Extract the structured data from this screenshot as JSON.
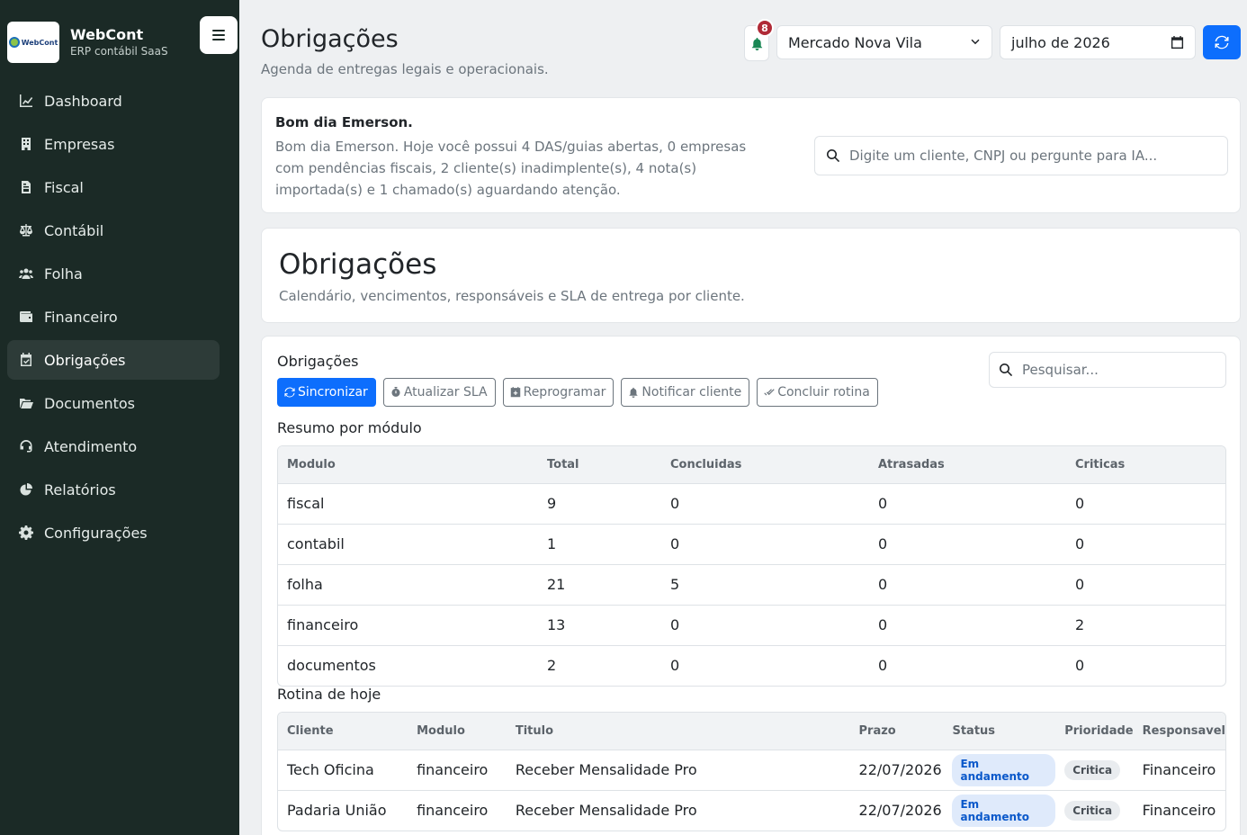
{
  "app": {
    "name": "WebCont",
    "tagline": "ERP contábil SaaS",
    "logo_text": "WebCont"
  },
  "sidebar": {
    "items": [
      {
        "label": "Dashboard",
        "icon": "chart-line-icon"
      },
      {
        "label": "Empresas",
        "icon": "building-icon"
      },
      {
        "label": "Fiscal",
        "icon": "file-invoice-icon"
      },
      {
        "label": "Contábil",
        "icon": "scale-icon"
      },
      {
        "label": "Folha",
        "icon": "users-icon"
      },
      {
        "label": "Financeiro",
        "icon": "wallet-icon"
      },
      {
        "label": "Obrigações",
        "icon": "calendar-check-icon",
        "active": true
      },
      {
        "label": "Documentos",
        "icon": "folder-open-icon"
      },
      {
        "label": "Atendimento",
        "icon": "headset-icon"
      },
      {
        "label": "Relatórios",
        "icon": "chart-pie-icon"
      },
      {
        "label": "Configurações",
        "icon": "gear-icon"
      }
    ]
  },
  "header": {
    "title": "Obrigações",
    "subtitle": "Agenda de entregas legais e operacionais.",
    "notification_count": "8",
    "company": "Mercado Nova Vila",
    "period": "julho de 2026"
  },
  "greeting": {
    "title": "Bom dia Emerson.",
    "text": "Bom dia Emerson. Hoje você possui 4 DAS/guias abertas, 0 empresas com pendências fiscais, 2 cliente(s) inadimplente(s), 4 nota(s) importada(s) e 1 chamado(s) aguardando atenção.",
    "search_placeholder": "Digite um cliente, CNPJ ou pergunte para IA..."
  },
  "hero": {
    "title": "Obrigações",
    "subtitle": "Calendário, vencimentos, responsáveis e SLA de entrega por cliente."
  },
  "panel": {
    "title": "Obrigações",
    "search_placeholder": "Pesquisar...",
    "buttons": {
      "sync": "Sincronizar",
      "sla": "Atualizar SLA",
      "reschedule": "Reprogramar",
      "notify": "Notificar cliente",
      "finish": "Concluir rotina"
    },
    "summary_title": "Resumo por módulo",
    "summary_headers": [
      "Modulo",
      "Total",
      "Concluidas",
      "Atrasadas",
      "Criticas"
    ],
    "summary_rows": [
      [
        "fiscal",
        "9",
        "0",
        "0",
        "0"
      ],
      [
        "contabil",
        "1",
        "0",
        "0",
        "0"
      ],
      [
        "folha",
        "21",
        "5",
        "0",
        "0"
      ],
      [
        "financeiro",
        "13",
        "0",
        "0",
        "2"
      ],
      [
        "documentos",
        "2",
        "0",
        "0",
        "0"
      ]
    ],
    "routine_title": "Rotina de hoje",
    "routine_headers": [
      "Cliente",
      "Modulo",
      "Titulo",
      "Prazo",
      "Status",
      "Prioridade",
      "Responsavel"
    ],
    "routine_rows": [
      [
        "Tech Oficina",
        "financeiro",
        "Receber Mensalidade Pro",
        "22/07/2026",
        "Em andamento",
        "Critica",
        "Financeiro"
      ],
      [
        "Padaria União",
        "financeiro",
        "Receber Mensalidade Pro",
        "22/07/2026",
        "Em andamento",
        "Critica",
        "Financeiro"
      ]
    ]
  }
}
